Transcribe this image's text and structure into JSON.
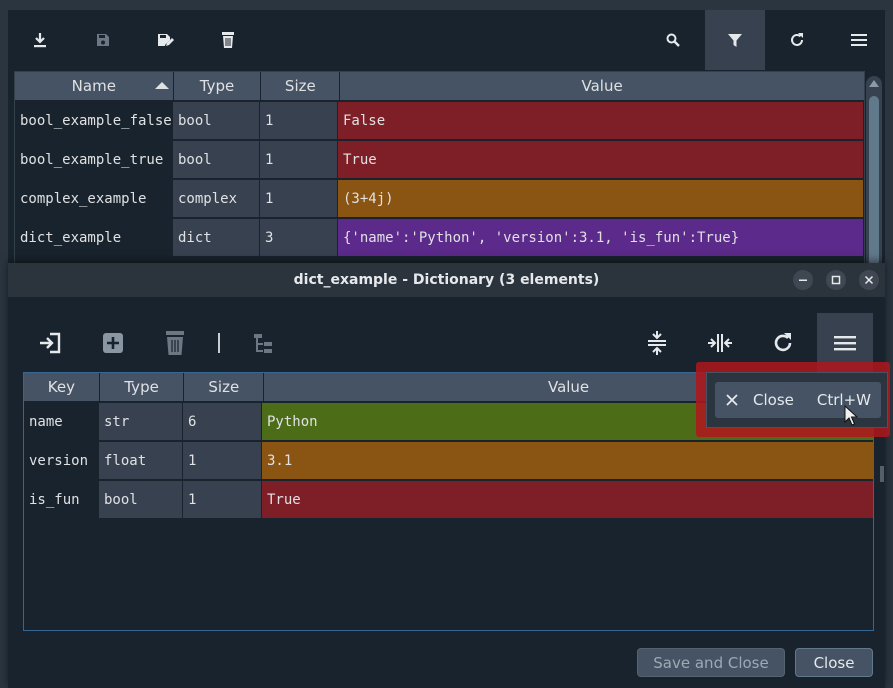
{
  "explorer": {
    "toolbar": {
      "left_icons": [
        "download-icon",
        "save-icon",
        "save-as-icon",
        "delete-icon"
      ],
      "right_icons": [
        "search-icon",
        "filter-icon",
        "refresh-icon",
        "menu-icon"
      ]
    },
    "columns": [
      "Name",
      "Type",
      "Size",
      "Value"
    ],
    "rows": [
      {
        "name": "bool_example_false",
        "type": "bool",
        "size": "1",
        "value": "False",
        "color": "#7e1f27"
      },
      {
        "name": "bool_example_true",
        "type": "bool",
        "size": "1",
        "value": "True",
        "color": "#7e1f27"
      },
      {
        "name": "complex_example",
        "type": "complex",
        "size": "1",
        "value": "(3+4j)",
        "color": "#8a5412"
      },
      {
        "name": "dict_example",
        "type": "dict",
        "size": "3",
        "value": "{'name':'Python', 'version':3.1, 'is_fun':True}",
        "color": "#5c2a8a"
      }
    ]
  },
  "dialog": {
    "title": "dict_example - Dictionary (3 elements)",
    "window_buttons": [
      "minimize-icon",
      "maximize-icon",
      "close-icon"
    ],
    "toolbar": {
      "left_icons": [
        "insert-icon",
        "add-icon",
        "delete-icon",
        "tree-icon"
      ],
      "right_icons": [
        "resize-rows-icon",
        "resize-columns-icon",
        "refresh-icon",
        "menu-icon"
      ]
    },
    "columns": [
      "Key",
      "Type",
      "Size",
      "Value"
    ],
    "rows": [
      {
        "key": "name",
        "type": "str",
        "size": "6",
        "value": "Python",
        "color": "#4c6c18"
      },
      {
        "key": "version",
        "type": "float",
        "size": "1",
        "value": "3.1",
        "color": "#8a5412"
      },
      {
        "key": "is_fun",
        "type": "bool",
        "size": "1",
        "value": "True",
        "color": "#7e1f27"
      }
    ],
    "menu": {
      "close_label": "Close",
      "close_shortcut": "Ctrl+W"
    },
    "buttons": {
      "save_close": "Save and Close",
      "close": "Close"
    }
  }
}
